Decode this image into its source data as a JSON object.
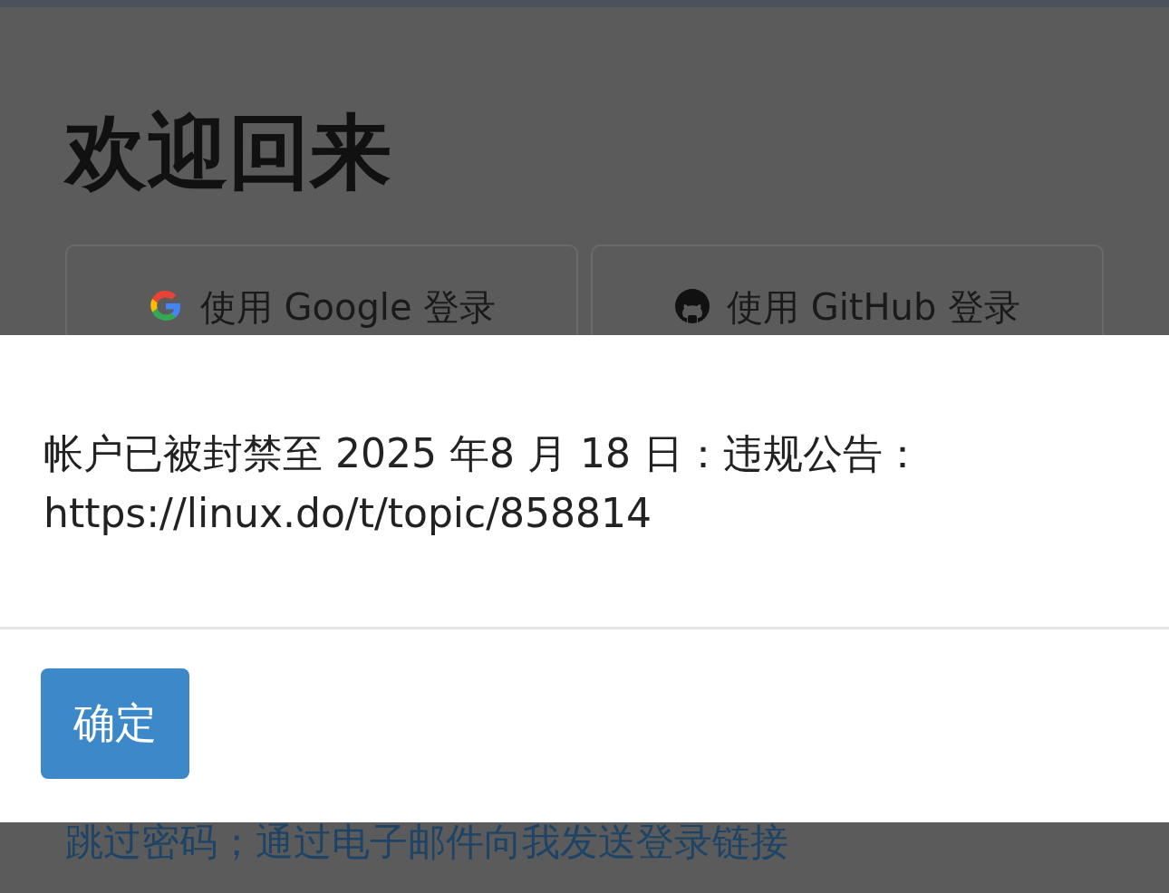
{
  "page": {
    "heading": "欢迎回来",
    "login_buttons": [
      {
        "kind": "google",
        "label": "使用 Google 登录"
      },
      {
        "kind": "github",
        "label": "使用 GitHub 登录"
      }
    ],
    "email_link": "跳过密码；通过电子邮件向我发送登录链接"
  },
  "dialog": {
    "message": "帐户已被封禁至 2025 年8 月 18 日：违规公告：https://linux.do/t/topic/858814",
    "buttons": [
      "确定"
    ]
  }
}
